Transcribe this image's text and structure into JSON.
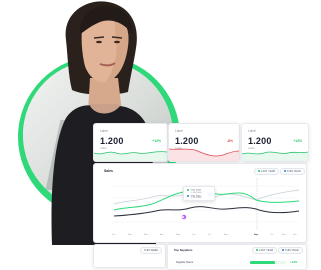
{
  "kpis": [
    {
      "label": "Label",
      "value": "1.200",
      "sublabel": "Label",
      "delta": "+12%",
      "trend": "up",
      "color": "#27c36a"
    },
    {
      "label": "Label",
      "value": "1.200",
      "sublabel": "Label",
      "delta": "-8%",
      "trend": "down",
      "color": "#e04752"
    },
    {
      "label": "Label",
      "value": "1.200",
      "sublabel": "Label",
      "delta": "+12%",
      "trend": "up",
      "color": "#27c36a"
    }
  ],
  "sales": {
    "title": "Sales",
    "filters": [
      "LAST YEAR",
      "THIS YEAR"
    ],
    "tooltip": [
      {
        "label": "YOU 2023",
        "value": "1.034.0000",
        "color": "#27c36a"
      },
      {
        "label": "YOU 2022",
        "value": "1.234.0000",
        "color": "#3a7bd5"
      }
    ],
    "months": [
      "Jan",
      "Feb",
      "Mar",
      "Apr",
      "May",
      "Jun",
      "Jul",
      "Aug",
      "Sep",
      "Oct",
      "Nov",
      "Dec"
    ],
    "highlight_month": "Sep"
  },
  "bottom": {
    "left_filter": "THIS WEEK",
    "right_title": "Top Suppliers",
    "right_filters": [
      "LAST YEAR",
      "THIS YEAR"
    ],
    "supplier_name": "Supplier Name",
    "supplier_delta": "+12%"
  },
  "colors": {
    "accent": "#2fd97a",
    "positive": "#27c36a",
    "negative": "#e04752"
  }
}
